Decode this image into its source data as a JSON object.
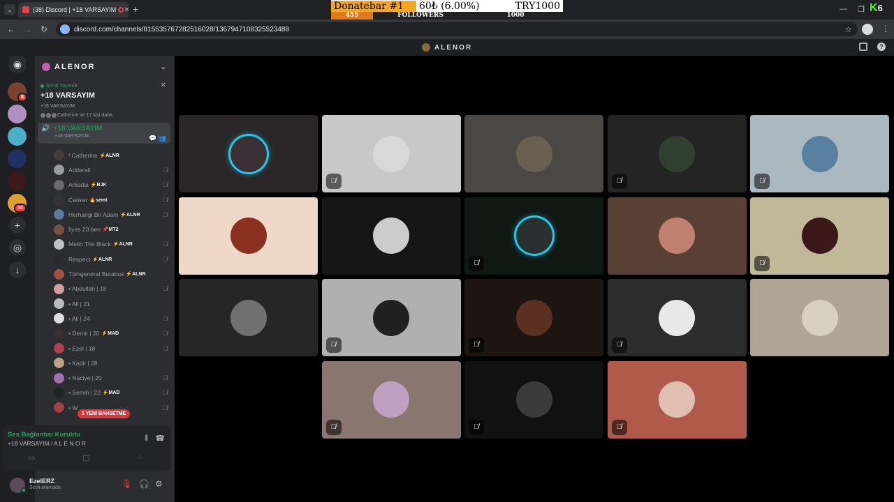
{
  "browser": {
    "tab_title": "(38) Discord | +18 VARSAYIM",
    "new_tab_icon": "+",
    "url": "discord.com/channels/815535767282516028/1367947108325523488"
  },
  "donatebar": {
    "label": "Donatebar #1",
    "amount": "60₺ (6.00%)",
    "goal": "TRY1000",
    "left": "455",
    "mid": "FOLLOWERS",
    "right": "1000"
  },
  "kick": {
    "letter": "K",
    "count": "6"
  },
  "discord": {
    "title": "ALENOR",
    "server_name": "ALENOR",
    "live": {
      "status": "Şimdi Yayında",
      "channel": "+18 VARSAYIM",
      "sub": "+18 VARSAYIM",
      "watchers": "Catherine ve 17 kişi daha"
    },
    "voice_channel": {
      "name": "+18 VARSAYIM",
      "sub": "+18 VARSAYIM"
    },
    "members": [
      {
        "name": "! Catherine",
        "tag": "⚡ALNR",
        "color": "#4a3a3a",
        "muted": false
      },
      {
        "name": "Adderall",
        "tag": "",
        "color": "#9a9a9a",
        "muted": true
      },
      {
        "name": "Arkadia",
        "tag": "⚡BJK",
        "color": "#6a6a6a",
        "muted": true
      },
      {
        "name": "Cenker",
        "tag": "🔥semt",
        "color": "#333333",
        "muted": true
      },
      {
        "name": "Herhangi Bir Adam",
        "tag": "⚡ALNR",
        "color": "#5a7aa0",
        "muted": true
      },
      {
        "name": "İlyas 23 ben",
        "tag": "📌MT2",
        "color": "#7a5040",
        "muted": false
      },
      {
        "name": "Metin The Black",
        "tag": "⚡ALNR",
        "color": "#c0c0c0",
        "muted": true
      },
      {
        "name": "Respect",
        "tag": "⚡ALNR",
        "color": "#2a2a2a",
        "muted": true
      },
      {
        "name": "Tümgeneral Burabus",
        "tag": "⚡ALNR",
        "color": "#a05040",
        "muted": false
      },
      {
        "name": "• Abdullah | 18",
        "tag": "",
        "color": "#d0a0a0",
        "muted": true
      },
      {
        "name": "• Ali | 21",
        "tag": "",
        "color": "#bbbbbb",
        "muted": false
      },
      {
        "name": "• Ali | 24",
        "tag": "",
        "color": "#dddddd",
        "muted": true
      },
      {
        "name": "• Demir | 20",
        "tag": "⚡MAD",
        "color": "#3a3030",
        "muted": true
      },
      {
        "name": "• Ezel | 18",
        "tag": "",
        "color": "#b04050",
        "muted": true
      },
      {
        "name": "• Kadir | 28",
        "tag": "",
        "color": "#c0a080",
        "muted": false
      },
      {
        "name": "• Naciye | 20",
        "tag": "",
        "color": "#a070b0",
        "muted": true
      },
      {
        "name": "• Semih | 22",
        "tag": "⚡MAD",
        "color": "#222222",
        "muted": true
      },
      {
        "name": "• W",
        "tag": "",
        "color": "#a04040",
        "muted": true
      }
    ],
    "mention_pill": "1 YENİ BAHSETME",
    "rtc": {
      "status": "Ses Bağlantısı Kuruldu",
      "channel": "+18 VARSAYIM / A L E N O R"
    },
    "me": {
      "name": "EzelERZ",
      "status": "Sesli aramada"
    },
    "rail_badges": {
      "first": "8",
      "fifth": "30"
    },
    "tiles": [
      {
        "bg": "#2a2628",
        "pic": "#3a3035",
        "ring": true,
        "muted": false
      },
      {
        "bg": "#c8c8c8",
        "pic": "#d8d8d8",
        "ring": false,
        "muted": true
      },
      {
        "bg": "#4a4744",
        "pic": "#6a6050",
        "ring": false,
        "muted": false
      },
      {
        "bg": "#242424",
        "pic": "#304030",
        "ring": false,
        "muted": true
      },
      {
        "bg": "#aab8c0",
        "pic": "#5a80a0",
        "ring": false,
        "muted": true
      },
      {
        "bg": "#f0d8c8",
        "pic": "#8a3020",
        "ring": false,
        "muted": false
      },
      {
        "bg": "#161616",
        "pic": "#cccccc",
        "ring": false,
        "muted": false
      },
      {
        "bg": "#101814",
        "pic": "#2a3030",
        "ring": true,
        "muted": true
      },
      {
        "bg": "#5a4034",
        "pic": "#c08070",
        "ring": false,
        "muted": false
      },
      {
        "bg": "#c0b898",
        "pic": "#3a1818",
        "ring": false,
        "muted": true
      },
      {
        "bg": "#262626",
        "pic": "#707070",
        "ring": false,
        "muted": false
      },
      {
        "bg": "#b0b0b0",
        "pic": "#202020",
        "ring": false,
        "muted": true
      },
      {
        "bg": "#1e1412",
        "pic": "#5a3020",
        "ring": false,
        "muted": true
      },
      {
        "bg": "#2c2c2c",
        "pic": "#e8e8e8",
        "ring": false,
        "muted": true
      },
      {
        "bg": "#b0a494",
        "pic": "#d8d0c0",
        "ring": false,
        "muted": false
      },
      null,
      {
        "bg": "#8a7670",
        "pic": "#c0a0c0",
        "ring": false,
        "muted": true
      },
      {
        "bg": "#111111",
        "pic": "#3a3a3a",
        "ring": false,
        "muted": true
      },
      {
        "bg": "#b05a4c",
        "pic": "#e0c0b0",
        "ring": false,
        "muted": true
      },
      null
    ]
  }
}
